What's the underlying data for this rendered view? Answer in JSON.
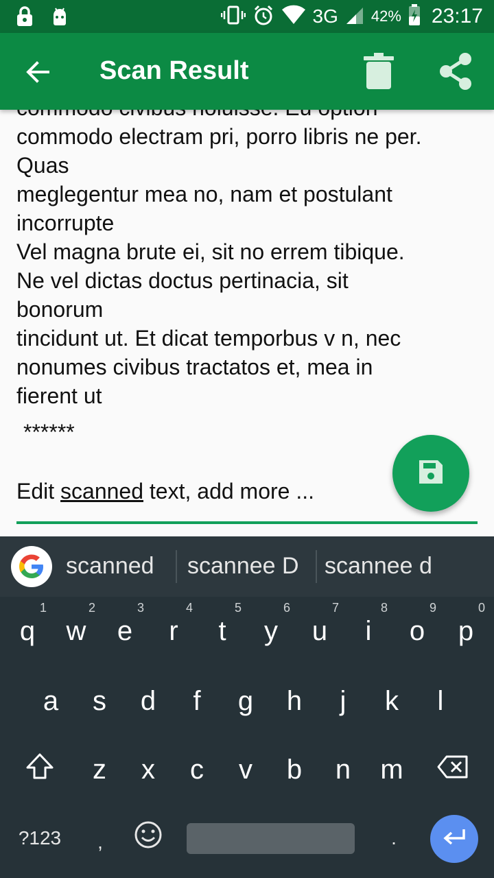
{
  "status_bar": {
    "battery_percent": "42%",
    "network": "3G",
    "time": "23:17"
  },
  "app_bar": {
    "title": "Scan Result",
    "back_icon": "arrow-back-icon",
    "actions": [
      "delete-icon",
      "share-icon"
    ]
  },
  "content": {
    "scan_lines": [
      "commodo civibus holuisse. Eu option",
      "commodo electram pri, porro libris ne per.",
      "Quas",
      "meglegentur mea no, nam et postulant",
      "incorrupte",
      "Vel magna brute ei, sit no errem tibique.",
      "Ne vel dictas doctus pertinacia, sit",
      "bonorum",
      "tincidunt ut. Et dicat temporbus v n, nec",
      "nonumes civibus tractatos et, mea in",
      "fierent ut"
    ],
    "stars": "******",
    "edit_prefix": "Edit ",
    "edit_underlined": "scanned",
    "edit_suffix": " text, add more ...",
    "fab_icon": "save-icon"
  },
  "keyboard": {
    "suggestions": [
      "scanned",
      "scannee D",
      "scannee d"
    ],
    "row1": [
      {
        "k": "q",
        "h": "1"
      },
      {
        "k": "w",
        "h": "2"
      },
      {
        "k": "e",
        "h": "3"
      },
      {
        "k": "r",
        "h": "4"
      },
      {
        "k": "t",
        "h": "5"
      },
      {
        "k": "y",
        "h": "6"
      },
      {
        "k": "u",
        "h": "7"
      },
      {
        "k": "i",
        "h": "8"
      },
      {
        "k": "o",
        "h": "9"
      },
      {
        "k": "p",
        "h": "0"
      }
    ],
    "row2": [
      "a",
      "s",
      "d",
      "f",
      "g",
      "h",
      "j",
      "k",
      "l"
    ],
    "row3": [
      "z",
      "x",
      "c",
      "v",
      "b",
      "n",
      "m"
    ],
    "symbols_label": "?123",
    "comma": ",",
    "period": "."
  },
  "colors": {
    "status_bar": "#0a6d35",
    "app_bar": "#0c8a44",
    "accent": "#12a05a",
    "keyboard_bg": "#263238",
    "enter_key": "#5b8ff0"
  }
}
